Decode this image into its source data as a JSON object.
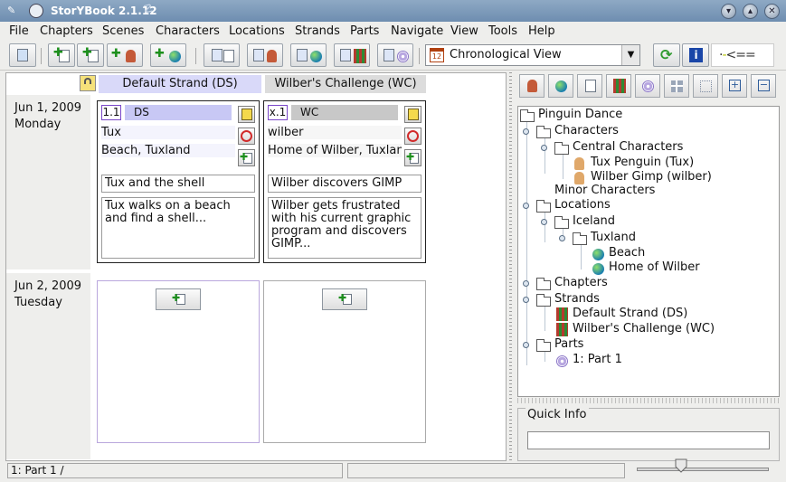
{
  "window": {
    "title": "StorYBook 2.1.12"
  },
  "menubar": [
    "File",
    "Chapters",
    "Scenes",
    "Characters",
    "Locations",
    "Strands",
    "Parts",
    "Navigate",
    "View",
    "Tools",
    "Help"
  ],
  "toolbar": {
    "view_select": "Chronological View",
    "calendar_icon_text": "12"
  },
  "strands": [
    {
      "label": "Default Strand (DS)",
      "color": "#d9d9f9"
    },
    {
      "label": "Wilber's Challenge (WC)",
      "color": "#dcdcdc"
    }
  ],
  "days": [
    {
      "date": "Jun 1, 2009",
      "weekday": "Monday"
    },
    {
      "date": "Jun 2, 2009",
      "weekday": "Tuesday"
    }
  ],
  "scenes": [
    {
      "number": "1.1",
      "strand_abbr": "DS",
      "character": "Tux",
      "location": "Beach, Tuxland",
      "title": "Tux and the shell",
      "summary": "Tux walks on a beach and find a shell...",
      "abbr_color": "#c8c8f5"
    },
    {
      "number": "x.1",
      "strand_abbr": "WC",
      "character": "wilber",
      "location": "Home of Wilber, Tuxland",
      "title": "Wilber discovers GIMP",
      "summary": "Wilber gets frustrated with his current graphic program and discovers GIMP...",
      "abbr_color": "#c8c8c8"
    }
  ],
  "tree": {
    "root": "Pinguin Dance",
    "characters": "Characters",
    "central": "Central Characters",
    "char1": "Tux Penguin (Tux)",
    "char2": "Wilber Gimp (wilber)",
    "minor": "Minor Characters",
    "locations": "Locations",
    "iceland": "Iceland",
    "tuxland": "Tuxland",
    "beach": "Beach",
    "home": "Home of Wilber",
    "chapters": "Chapters",
    "strands": "Strands",
    "strand1": "Default Strand (DS)",
    "strand2": "Wilber's Challenge (WC)",
    "parts": "Parts",
    "part1": "1: Part 1"
  },
  "quick_info": {
    "label": "Quick Info",
    "value": ""
  },
  "statusbar": {
    "part": "1: Part 1 /"
  }
}
